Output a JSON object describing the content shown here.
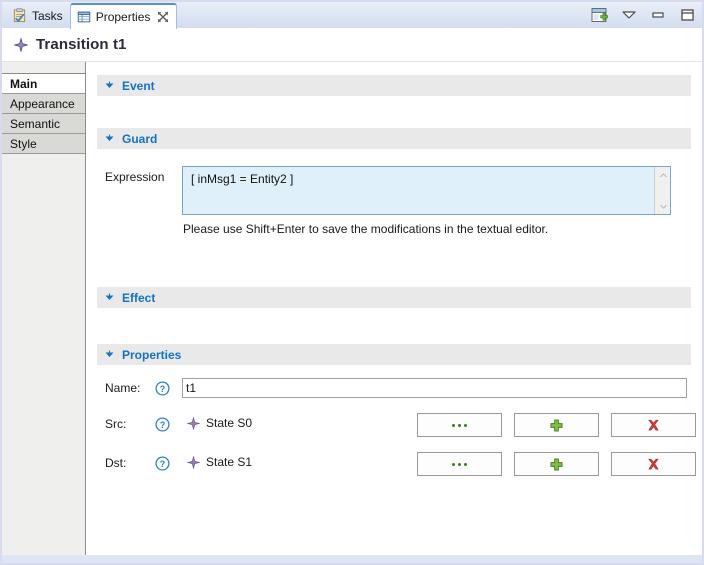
{
  "window": {
    "tabs": [
      {
        "label": "Tasks",
        "icon": "tasks-clipboard-icon",
        "active": false,
        "closable": false
      },
      {
        "label": "Properties",
        "icon": "properties-table-icon",
        "active": true,
        "closable": true
      }
    ],
    "toolbar": [
      {
        "name": "new-properties-view-icon",
        "tooltip": "New Properties View"
      },
      {
        "name": "view-menu-chevron-icon",
        "tooltip": "View Menu"
      },
      {
        "name": "minimize-icon",
        "tooltip": "Minimize"
      },
      {
        "name": "maximize-icon",
        "tooltip": "Maximize"
      }
    ]
  },
  "form": {
    "title": "Transition t1",
    "title_icon": "transition-diamond-icon"
  },
  "sidebar": {
    "items": [
      {
        "label": "Main",
        "selected": true
      },
      {
        "label": "Appearance",
        "selected": false
      },
      {
        "label": "Semantic",
        "selected": false
      },
      {
        "label": "Style",
        "selected": false
      }
    ]
  },
  "sections": {
    "event": {
      "title": "Event",
      "expanded": true
    },
    "guard": {
      "title": "Guard",
      "expanded": true,
      "expression_label": "Expression",
      "expression_value": "[ inMsg1 = Entity2 ]",
      "hint": "Please use Shift+Enter to save the modifications in the textual editor."
    },
    "effect": {
      "title": "Effect",
      "expanded": true
    },
    "properties": {
      "title": "Properties",
      "expanded": true,
      "rows": [
        {
          "label": "Name:",
          "type": "text",
          "value": "t1",
          "placeholder": "",
          "help": "?"
        },
        {
          "label": "Src:",
          "type": "reference",
          "value": "State S0",
          "icon": "state-diamond-icon",
          "help": "?",
          "buttons": [
            {
              "name": "browse-button",
              "icon": "ellipsis-icon",
              "label": "..."
            },
            {
              "name": "add-button",
              "icon": "plus-icon",
              "label": "+"
            },
            {
              "name": "remove-button",
              "icon": "delete-x-icon",
              "label": "x"
            }
          ]
        },
        {
          "label": "Dst:",
          "type": "reference",
          "value": "State S1",
          "icon": "state-diamond-icon",
          "help": "?",
          "buttons": [
            {
              "name": "browse-button",
              "icon": "ellipsis-icon",
              "label": "..."
            },
            {
              "name": "add-button",
              "icon": "plus-icon",
              "label": "+"
            },
            {
              "name": "remove-button",
              "icon": "delete-x-icon",
              "label": "x"
            }
          ]
        }
      ]
    }
  },
  "colors": {
    "section_title": "#1272c4",
    "expression_bg": "#dff0fa",
    "accent_add": "#5fa830",
    "accent_remove": "#d23f3f",
    "diamond": "#8b6fa8"
  }
}
